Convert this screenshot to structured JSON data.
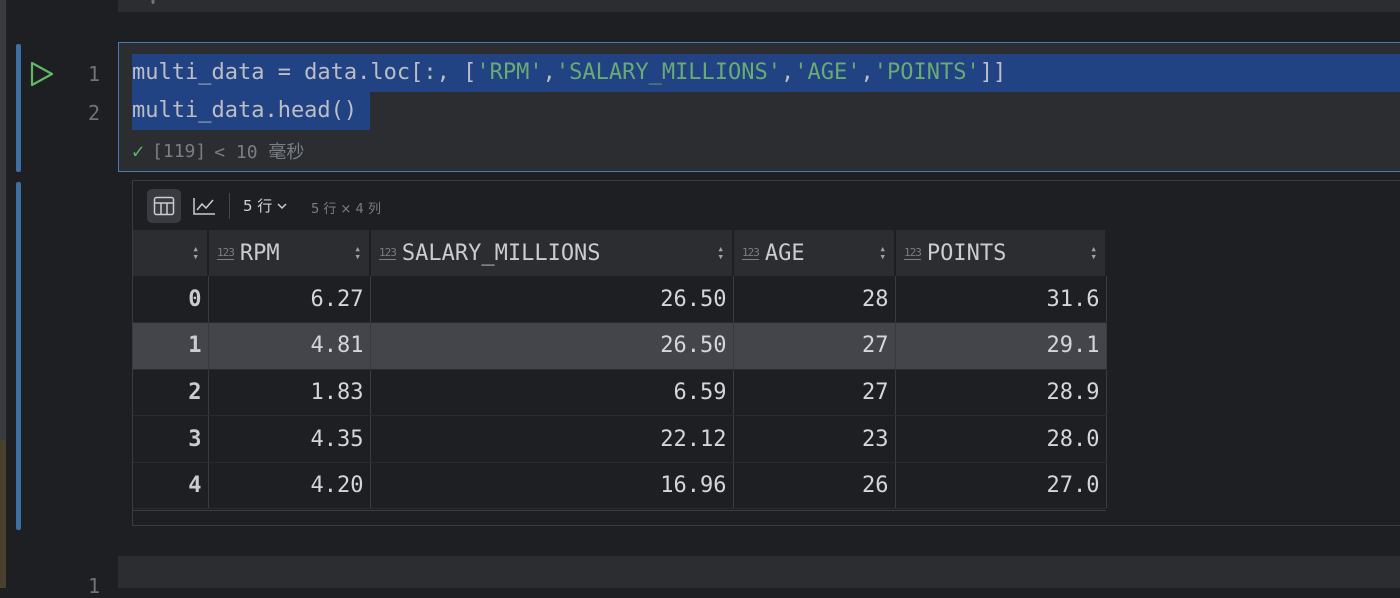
{
  "code_cell": {
    "line_numbers": [
      "1",
      "2"
    ],
    "line1": {
      "prefix": "multi_data = data.loc[:, [",
      "s1": "'RPM'",
      "comma1": ",",
      "s2": "'SALARY_MILLIONS'",
      "comma2": ",",
      "s3": "'AGE'",
      "comma3": ",",
      "s4": "'POINTS'",
      "suffix": "]]"
    },
    "line2": "multi_data.head()",
    "status": {
      "execution": "[119]",
      "duration": "< 10 毫秒"
    }
  },
  "output": {
    "toolbar": {
      "rows_selector": "5 行",
      "dimensions": "5 行 × 4 列"
    },
    "table": {
      "type_badge": "123",
      "columns": [
        "RPM",
        "SALARY_MILLIONS",
        "AGE",
        "POINTS"
      ],
      "rows": [
        {
          "index": "0",
          "values": [
            "6.27",
            "26.50",
            "28",
            "31.6"
          ]
        },
        {
          "index": "1",
          "values": [
            "4.81",
            "26.50",
            "27",
            "29.1"
          ]
        },
        {
          "index": "2",
          "values": [
            "1.83",
            "6.59",
            "27",
            "28.9"
          ]
        },
        {
          "index": "3",
          "values": [
            "4.35",
            "22.12",
            "23",
            "28.0"
          ]
        },
        {
          "index": "4",
          "values": [
            "4.20",
            "16.96",
            "26",
            "27.0"
          ]
        }
      ],
      "highlighted_row": 1
    }
  },
  "next_cell": {
    "line_number": "1"
  },
  "colors": {
    "accent": "#3d6fa3",
    "selection": "#214283",
    "string": "#6aab73",
    "success": "#5fb865",
    "run_icon": "#5fb865"
  },
  "icons": [
    "run-icon",
    "check-icon",
    "table-view-icon",
    "chart-view-icon",
    "chevron-down-icon",
    "sort-icon",
    "number-type-icon"
  ]
}
